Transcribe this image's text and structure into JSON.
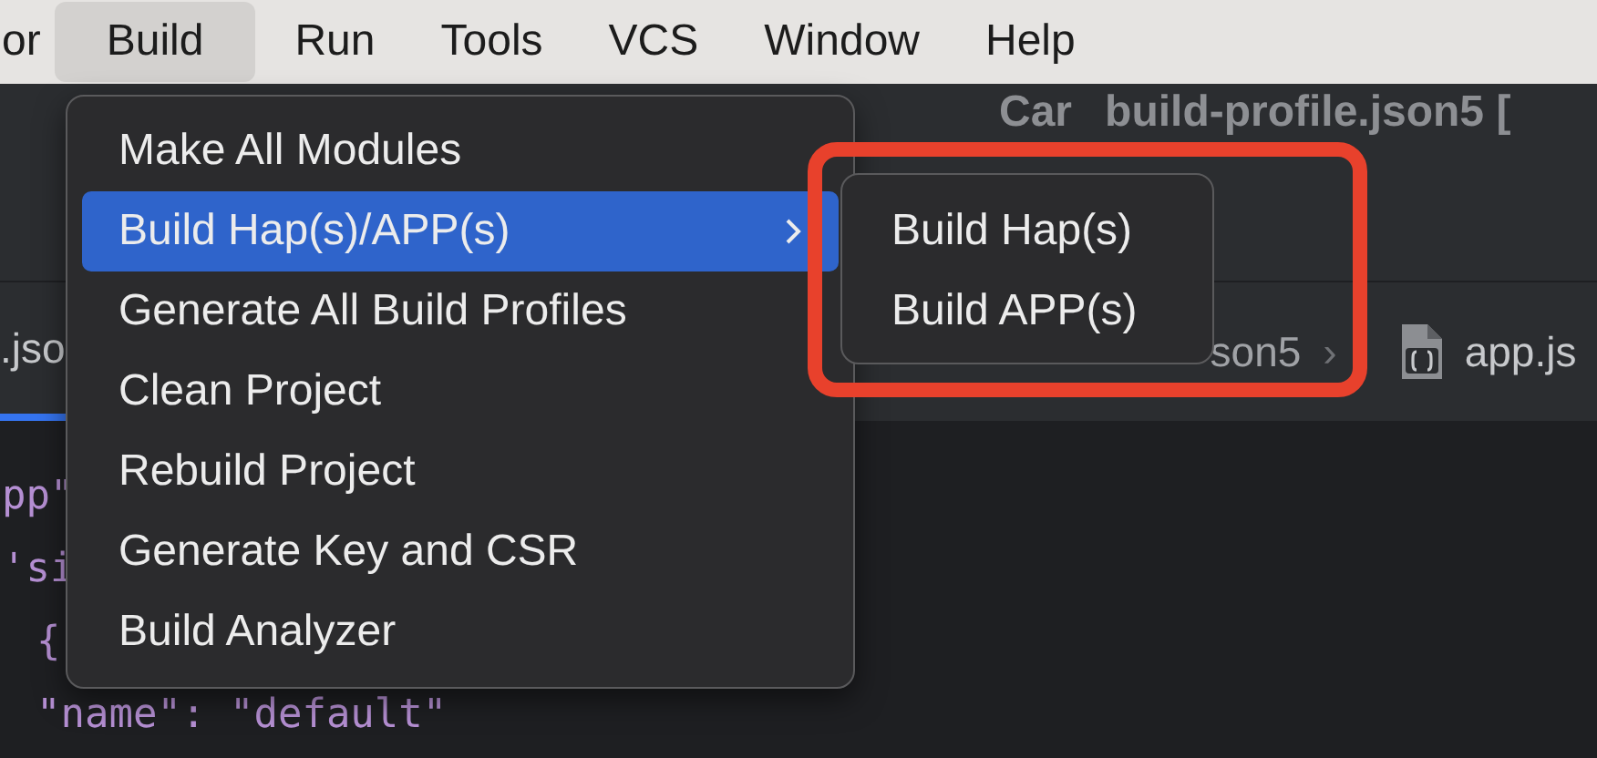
{
  "menubar": [
    {
      "label": "or",
      "selected": false
    },
    {
      "label": "Build",
      "selected": true
    },
    {
      "label": "Run",
      "selected": false
    },
    {
      "label": "Tools",
      "selected": false
    },
    {
      "label": "VCS",
      "selected": false
    },
    {
      "label": "Window",
      "selected": false
    },
    {
      "label": "Help",
      "selected": false
    }
  ],
  "window_title": [
    "Car",
    "build-profile.json5 ["
  ],
  "editor_tabs": [
    {
      "label": ".jso",
      "selected": true
    }
  ],
  "breadcrumb": [
    {
      "label": "son5",
      "separator": "›"
    }
  ],
  "file_tab": {
    "label": "app.js"
  },
  "code_lines": [
    {
      "text": "pp\"",
      "indent": false
    },
    {
      "text": "'si",
      "indent": false
    },
    {
      "text": "{",
      "indent": true
    },
    {
      "text": "\"name\": \"default\"",
      "indent": true
    }
  ],
  "build_menu": [
    {
      "label": "Make All Modules",
      "selected": false,
      "submenu": false
    },
    {
      "label": "Build Hap(s)/APP(s)",
      "selected": true,
      "submenu": true
    },
    {
      "label": "Generate All Build Profiles",
      "selected": false,
      "submenu": false
    },
    {
      "label": "Clean Project",
      "selected": false,
      "submenu": false
    },
    {
      "label": "Rebuild Project",
      "selected": false,
      "submenu": false
    },
    {
      "label": "Generate Key and CSR",
      "selected": false,
      "submenu": false
    },
    {
      "label": "Build Analyzer",
      "selected": false,
      "submenu": false
    }
  ],
  "submenu": [
    {
      "label": "Build Hap(s)",
      "selected": false
    },
    {
      "label": "Build APP(s)",
      "selected": false
    }
  ],
  "annotation": {
    "kind": "rectangle",
    "color": "#e8412c"
  }
}
